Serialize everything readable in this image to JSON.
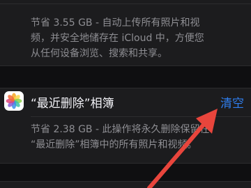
{
  "icloud_upload": {
    "description_lines": [
      "节省 3.55 GB - 自动上传所有照片和视",
      "频，并安全地储存在 iCloud 中，方便您",
      "从任何设备浏览、搜索和共享。"
    ]
  },
  "recently_deleted": {
    "icon": "photos-app-icon",
    "title": "“最近删除”相簿",
    "action_label": "清空",
    "description_lines": [
      "节省 2.38 GB - 此操作将永久删除保留在",
      "“最近删除”相簿中的所有照片和视频。"
    ]
  },
  "colors": {
    "accent": "#2f7ff0",
    "annotation_arrow": "#e8453c"
  }
}
